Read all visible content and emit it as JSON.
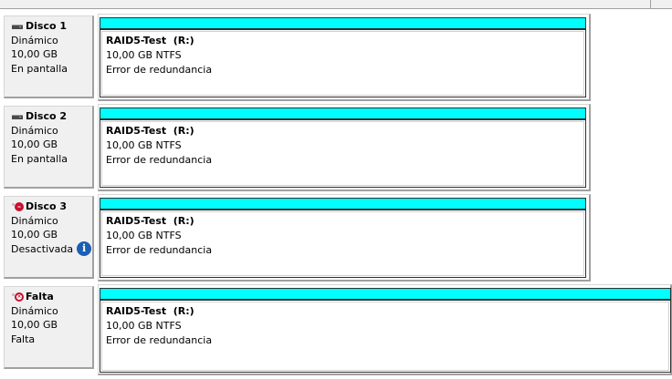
{
  "disks": [
    {
      "name": "Disco 1",
      "icon": "hard-disk-icon",
      "type": "Dinámico",
      "size": "10,00 GB",
      "status": "En pantalla",
      "volume": {
        "name": "RAID5-Test  (R:)",
        "details": "10,00 GB NTFS",
        "status": "Error de redundancia"
      }
    },
    {
      "name": "Disco 2",
      "icon": "hard-disk-icon",
      "type": "Dinámico",
      "size": "10,00 GB",
      "status": "En pantalla",
      "volume": {
        "name": "RAID5-Test  (R:)",
        "details": "10,00 GB NTFS",
        "status": "Error de redundancia"
      }
    },
    {
      "name": "Disco 3",
      "icon": "disk-error-icon",
      "type": "Dinámico",
      "size": "10,00 GB",
      "status": "Desactivada",
      "has_info": true,
      "volume": {
        "name": "RAID5-Test  (R:)",
        "details": "10,00 GB NTFS",
        "status": "Error de redundancia"
      }
    },
    {
      "name": "Falta",
      "icon": "disk-missing-icon",
      "type": "Dinámico",
      "size": "10,00 GB",
      "status": "Falta",
      "volume": {
        "name": "RAID5-Test  (R:)",
        "details": "10,00 GB NTFS",
        "status": "Error de redundancia"
      }
    }
  ],
  "colors": {
    "volume_bar": "#00ffff",
    "panel_bg": "#f0f0f0",
    "error_red": "#c8102e",
    "info_blue": "#1a5fb4"
  }
}
